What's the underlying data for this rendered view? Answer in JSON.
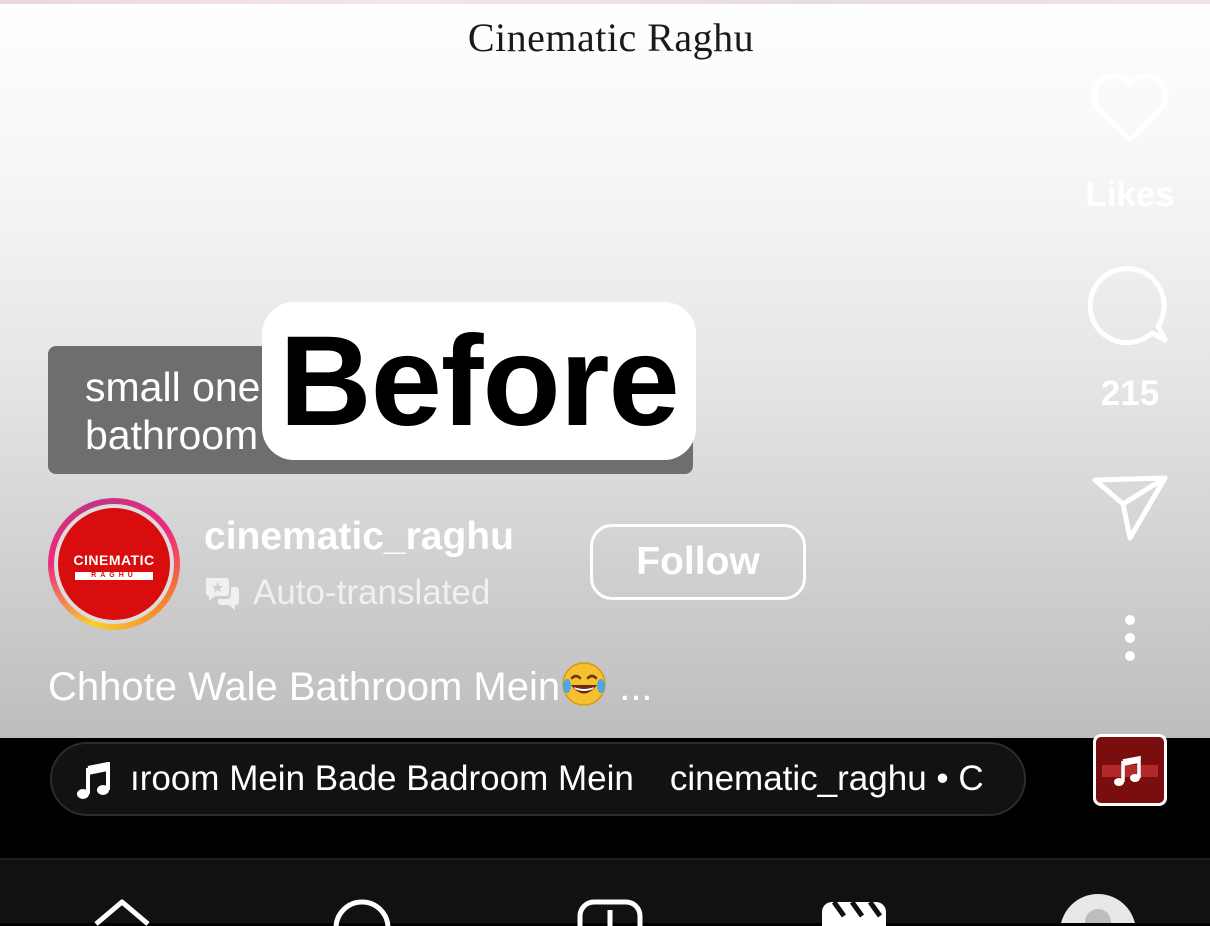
{
  "video": {
    "brand_title": "Cinematic Raghu",
    "sticker_grey_line1": "small one",
    "sticker_grey_line2": "bathroom",
    "sticker_main": "Before"
  },
  "author": {
    "avatar_text": "CINEMATIC",
    "avatar_subtext": "RAGHU",
    "username": "cinematic_raghu",
    "translation_label": "Auto-translated",
    "follow_label": "Follow"
  },
  "caption": {
    "text": "Chhote Wale Bathroom Mein",
    "more": " ..."
  },
  "actions": {
    "likes_label": "Likes",
    "comments_count": "215"
  },
  "audio": {
    "track_text": "ıroom Mein Bade Badroom Mein",
    "artist_text": "cinematic_raghu • C"
  },
  "bottom_nav": [
    "home",
    "search",
    "create",
    "reels",
    "profile"
  ],
  "colors": {
    "brand_red": "#d90d0d",
    "bar_black": "#000000",
    "nav_bg": "#111111"
  }
}
